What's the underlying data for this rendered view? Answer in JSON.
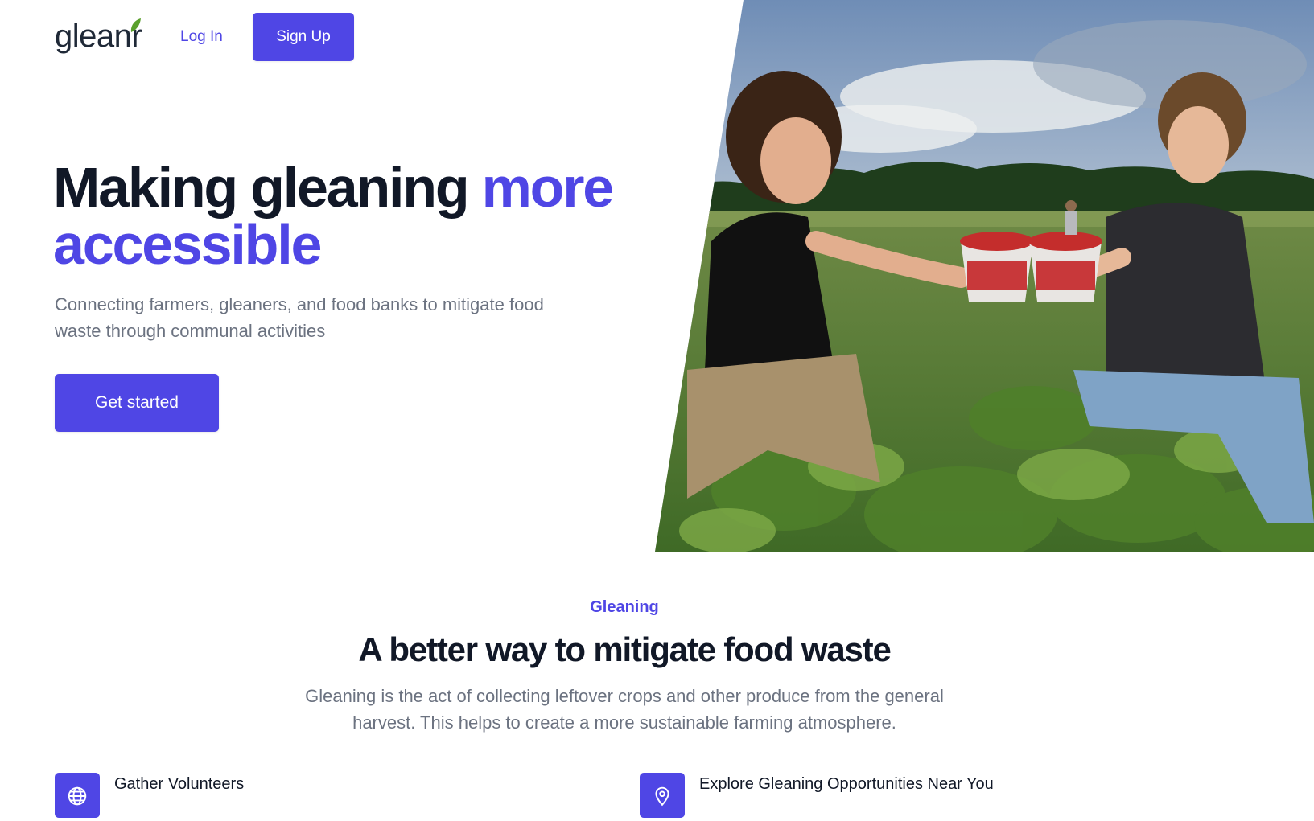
{
  "header": {
    "logo_text": "gleanr",
    "login_label": "Log In",
    "signup_label": "Sign Up"
  },
  "hero": {
    "title_part1": "Making gleaning ",
    "title_accent": "more accessible",
    "subtitle": "Connecting farmers, gleaners, and food banks to mitigate food waste through communal activities",
    "cta_label": "Get started"
  },
  "features_section": {
    "eyebrow": "Gleaning",
    "title": "A better way to mitigate food waste",
    "description": "Gleaning is the act of collecting leftover crops and other produce from the general harvest. This helps to create a more sustainable farming atmosphere.",
    "items": [
      {
        "title": "Gather Volunteers",
        "icon": "globe-icon"
      },
      {
        "title": "Explore Gleaning Opportunities Near You",
        "icon": "map-pin-icon"
      }
    ]
  },
  "colors": {
    "accent": "#4f46e5",
    "text_dark": "#111827",
    "text_muted": "#6b7280"
  }
}
